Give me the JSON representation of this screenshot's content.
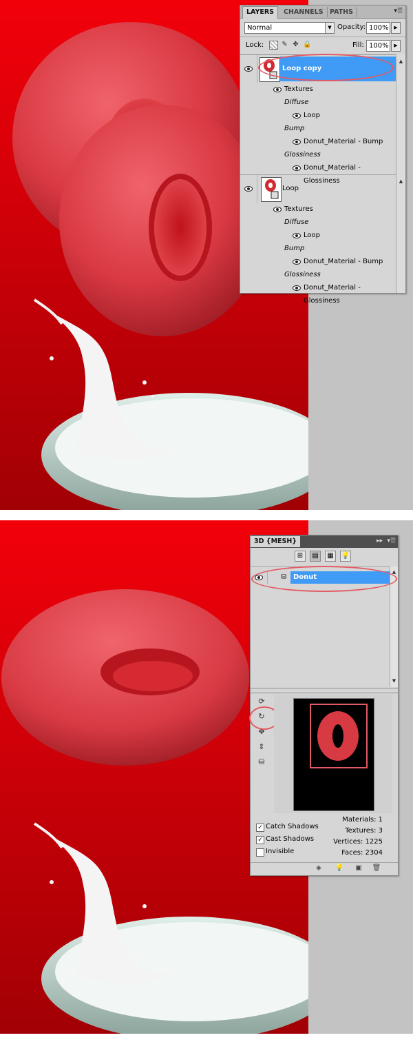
{
  "layers_panel": {
    "tabs": [
      {
        "label": "LAYERS",
        "active": true
      },
      {
        "label": "CHANNELS",
        "active": false
      },
      {
        "label": "PATHS",
        "active": false
      }
    ],
    "blend_mode": "Normal",
    "opacity_label": "Opacity:",
    "opacity_value": "100%",
    "lock_label": "Lock:",
    "fill_label": "Fill:",
    "fill_value": "100%",
    "layers": [
      {
        "name": "Loop copy",
        "selected": true,
        "textures_label": "Textures",
        "groups": [
          {
            "label": "Diffuse",
            "item": "Loop"
          },
          {
            "label": "Bump",
            "item": "Donut_Material - Bump"
          },
          {
            "label": "Glossiness",
            "item": "Donut_Material - Glossiness"
          }
        ]
      },
      {
        "name": "Loop",
        "selected": false,
        "textures_label": "Textures",
        "groups": [
          {
            "label": "Diffuse",
            "item": "Loop"
          },
          {
            "label": "Bump",
            "item": "Donut_Material - Bump"
          },
          {
            "label": "Glossiness",
            "item": "Donut_Material - Glossiness"
          }
        ]
      }
    ]
  },
  "mesh_panel": {
    "title": "3D {MESH}",
    "mesh_name": "Donut",
    "checkboxes": [
      {
        "label": "Catch Shadows",
        "checked": true
      },
      {
        "label": "Cast Shadows",
        "checked": true
      },
      {
        "label": "Invisible",
        "checked": false
      }
    ],
    "stats": [
      {
        "label": "Materials: 1"
      },
      {
        "label": "Textures: 3"
      },
      {
        "label": "Vertices: 1225"
      },
      {
        "label": "Faces: 2304"
      }
    ]
  },
  "colors": {
    "background_red": "#e8000c",
    "donut_red": "#e8434b",
    "selection_blue": "#3f9bf6",
    "highlight_oval": "#e35a64",
    "panel_gray": "#d6d6d6"
  }
}
